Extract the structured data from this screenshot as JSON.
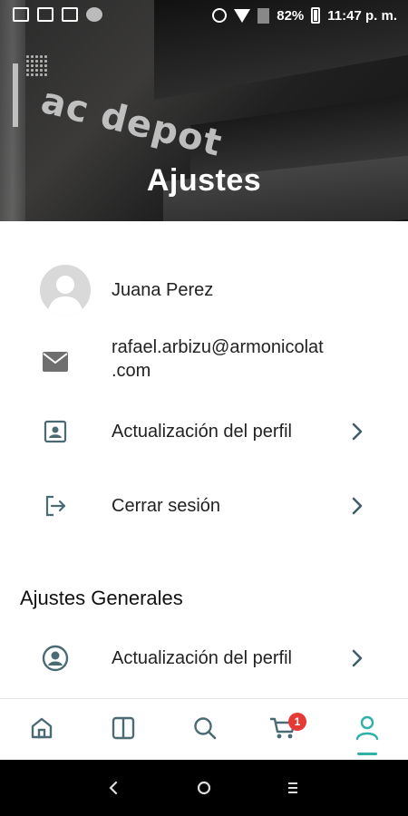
{
  "status_bar": {
    "battery": "82%",
    "time": "11:47 p. m."
  },
  "header": {
    "title": "Ajustes",
    "background_text": "ac depot"
  },
  "profile": {
    "name": "Juana Perez",
    "email_line1": "rafael.arbizu@armonicolat",
    "email_line2": ".com",
    "update_profile": "Actualización del perfil",
    "logout": "Cerrar sesión"
  },
  "general": {
    "title": "Ajustes Generales",
    "update_profile": "Actualización del perfil"
  },
  "bottom_nav": {
    "items": [
      "home-icon",
      "catalog-icon",
      "search-icon",
      "cart-icon",
      "profile-icon"
    ],
    "cart_badge": "1",
    "active_color": "#2fb0a8"
  },
  "colors": {
    "icon": "#4b6b74",
    "chevron": "#3f5f6a"
  }
}
